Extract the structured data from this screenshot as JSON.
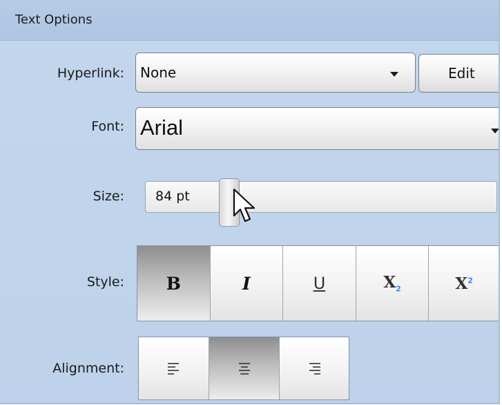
{
  "panel": {
    "title": "Text Options"
  },
  "hyperlink": {
    "label": "Hyperlink:",
    "value": "None",
    "edit_label": "Edit"
  },
  "font": {
    "label": "Font:",
    "value": "Arial"
  },
  "size": {
    "label": "Size:",
    "value": "84 pt",
    "level": 0.24
  },
  "style": {
    "label": "Style:",
    "buttons": [
      {
        "name": "bold",
        "icon": "bold-icon",
        "glyph": "B",
        "active": true
      },
      {
        "name": "italic",
        "icon": "italic-icon",
        "glyph": "I",
        "active": false
      },
      {
        "name": "underline",
        "icon": "underline-icon",
        "glyph": "U",
        "active": false
      },
      {
        "name": "subscript",
        "icon": "subscript-icon",
        "glyph": "X",
        "sub": "2",
        "active": false
      },
      {
        "name": "superscript",
        "icon": "superscript-icon",
        "glyph": "X",
        "sup": "2",
        "active": false
      }
    ]
  },
  "alignment": {
    "label": "Alignment:",
    "buttons": [
      {
        "name": "left",
        "icon": "align-left-icon",
        "active": false
      },
      {
        "name": "center",
        "icon": "align-center-icon",
        "active": true
      },
      {
        "name": "right",
        "icon": "align-right-icon",
        "active": false
      }
    ]
  },
  "colors": {
    "panel": "#bdd2ea",
    "header": "#aec5e3",
    "accent": "#3b86e4"
  }
}
